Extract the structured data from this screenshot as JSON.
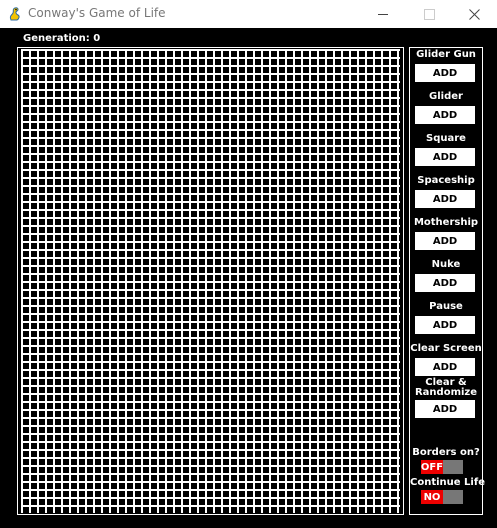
{
  "window": {
    "title": "Conway's Game of Life",
    "icon": "pygame-snake-icon",
    "controls": {
      "minimize": "—",
      "maximize": "☐",
      "close": "✕"
    }
  },
  "status": {
    "generation_label": "Generation: 0"
  },
  "panel": {
    "patterns": [
      {
        "label": "Glider Gun",
        "button": "ADD"
      },
      {
        "label": "Glider",
        "button": "ADD"
      },
      {
        "label": "Square",
        "button": "ADD"
      },
      {
        "label": "Spaceship",
        "button": "ADD"
      },
      {
        "label": "Mothership",
        "button": "ADD"
      },
      {
        "label": "Nuke",
        "button": "ADD"
      },
      {
        "label": "Pause",
        "button": "ADD"
      },
      {
        "label": "Clear Screen",
        "button": "ADD"
      }
    ],
    "clear_randomize": {
      "line1": "Clear &",
      "line2": "Randomize",
      "button": "ADD"
    },
    "toggles": {
      "borders": {
        "label": "Borders on?",
        "value": "OFF"
      },
      "continue_life": {
        "label": "Continue Life",
        "value": "NO"
      }
    }
  },
  "colors": {
    "background": "#000000",
    "grid_lines": "#ffffff",
    "toggle_active": "#e00000",
    "toggle_track": "#777777"
  }
}
